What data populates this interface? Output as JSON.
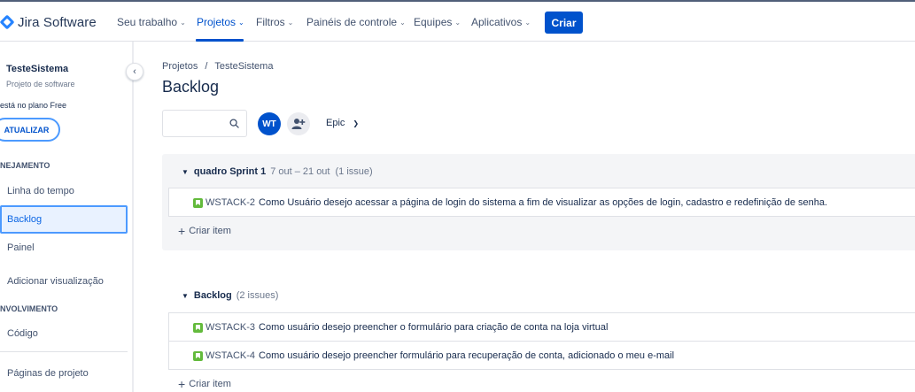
{
  "topnav": {
    "brand": "Jira Software",
    "items": [
      {
        "label": "Seu trabalho"
      },
      {
        "label": "Projetos"
      },
      {
        "label": "Filtros"
      },
      {
        "label": "Painéis de controle"
      },
      {
        "label": "Equipes"
      },
      {
        "label": "Aplicativos"
      }
    ],
    "create_label": "Criar"
  },
  "sidebar": {
    "project_name": "TesteSistema",
    "project_type": "Projeto de software",
    "plan_text": "está no plano Free",
    "upgrade_label": "ATUALIZAR",
    "sections": [
      {
        "heading": "NEJAMENTO"
      },
      {
        "heading": "NVOLVIMENTO"
      }
    ],
    "items": [
      {
        "label": "Linha do tempo"
      },
      {
        "label": "Backlog"
      },
      {
        "label": "Painel"
      },
      {
        "label": "Adicionar visualização"
      },
      {
        "label": "Código"
      },
      {
        "label": "Páginas de projeto"
      }
    ]
  },
  "main": {
    "breadcrumb": [
      "Projetos",
      "/",
      "TesteSistema"
    ],
    "title": "Backlog",
    "avatar_initials": "WT",
    "epic_filter": "Epic",
    "sprint": {
      "name": "quadro Sprint 1",
      "dates": "7 out – 21 out",
      "count": "(1 issue)",
      "issues": [
        {
          "key": "WSTACK-2",
          "summary": "Como Usuário desejo acessar a página de login do sistema a fim de visualizar as opções de login, cadastro e redefinição de senha."
        }
      ],
      "create_label": "Criar item"
    },
    "backlog": {
      "name": "Backlog",
      "count": "(2 issues)",
      "issues": [
        {
          "key": "WSTACK-3",
          "summary": "Como usuário desejo preencher o formulário para criação de conta na loja virtual"
        },
        {
          "key": "WSTACK-4",
          "summary": "Como usuário desejo preencher formulário para recuperação de conta, adicionado o meu e-mail"
        }
      ],
      "create_label": "Criar item"
    }
  },
  "colors": {
    "accent": "#0052cc",
    "story": "#63ba3c",
    "selected_bg": "#e9f2ff"
  }
}
